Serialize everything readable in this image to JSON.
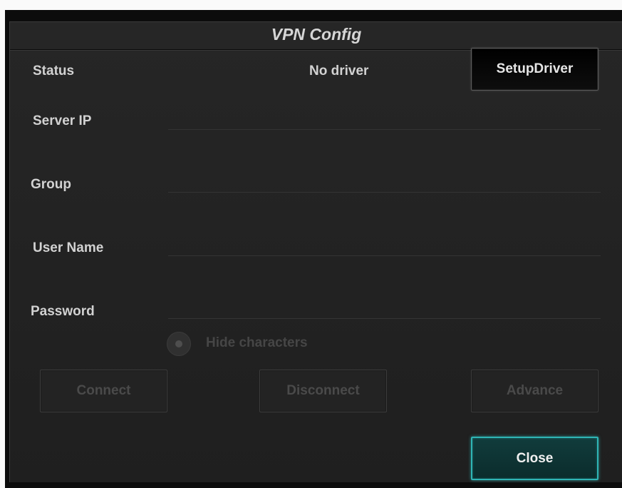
{
  "dialog": {
    "title": "VPN Config"
  },
  "status": {
    "label": "Status",
    "value": "No driver",
    "setup_button_label": "SetupDriver"
  },
  "fields": {
    "server_ip": {
      "label": "Server IP",
      "value": ""
    },
    "group": {
      "label": "Group",
      "value": ""
    },
    "user_name": {
      "label": "User Name",
      "value": ""
    },
    "password": {
      "label": "Password",
      "value": ""
    }
  },
  "options": {
    "hide_characters_label": "Hide characters",
    "hide_characters_enabled": false
  },
  "buttons": {
    "connect": "Connect",
    "disconnect": "Disconnect",
    "advance": "Advance",
    "close": "Close"
  },
  "colors": {
    "background": "#222222",
    "accent": "#2fb5b5",
    "text": "#d2d2d2",
    "disabled_text": "#4a4a4a"
  }
}
